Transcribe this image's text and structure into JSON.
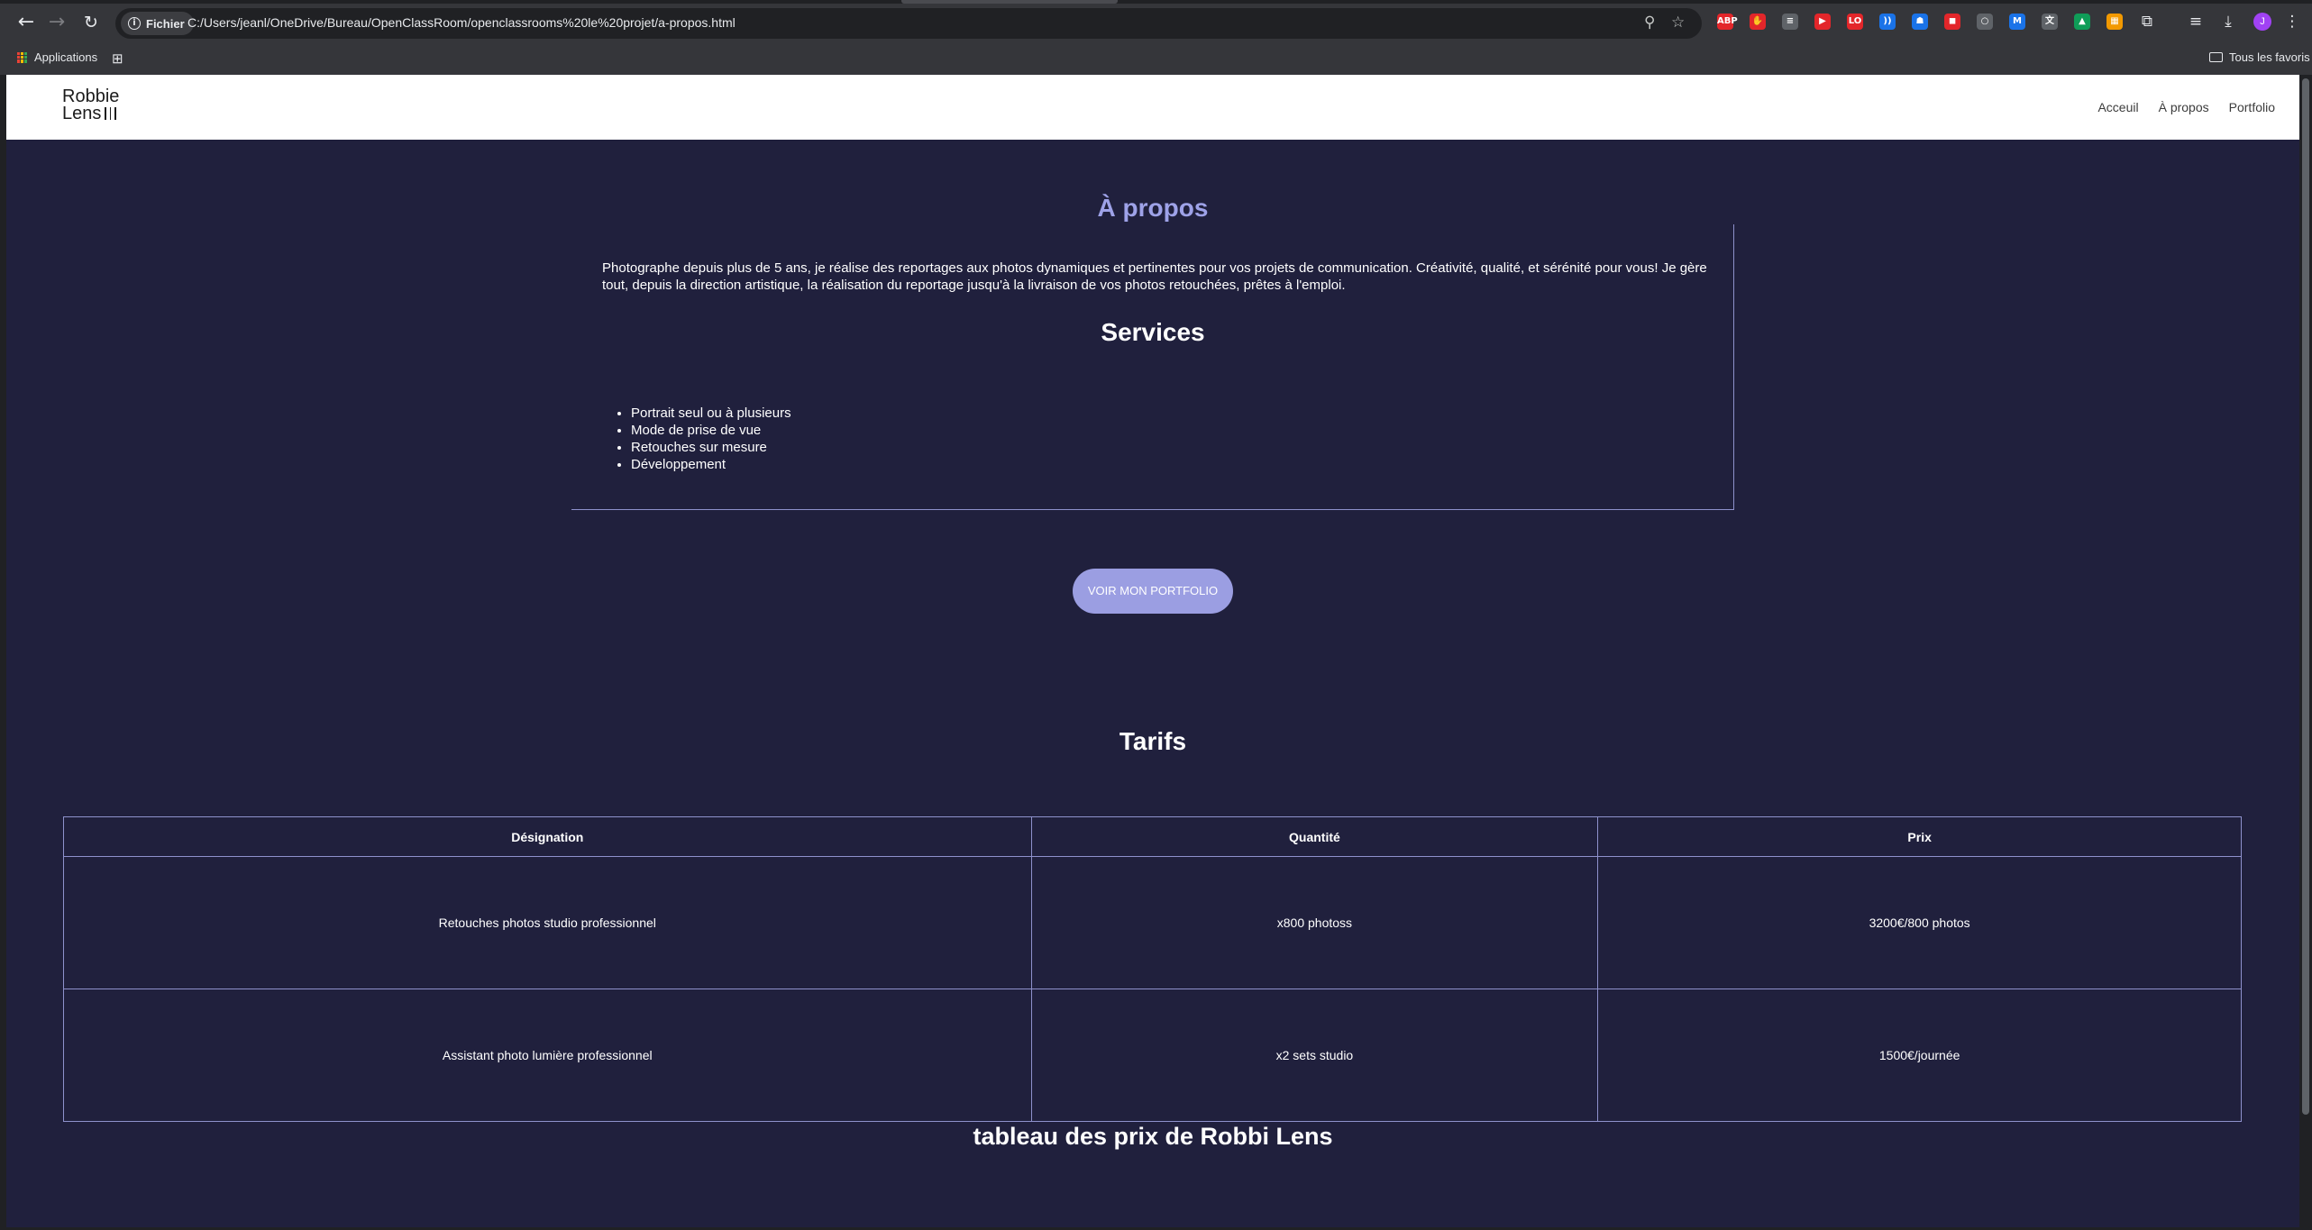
{
  "browser": {
    "url_chip_label": "Fichier",
    "url": "C:/Users/jeanl/OneDrive/Bureau/OpenClassRoom/openclassrooms%20le%20projet/a-propos.html",
    "profile_initial": "J",
    "bookmarks": {
      "applications": "Applications",
      "all_bookmarks": "Tous les favoris"
    },
    "extensions": [
      {
        "label": "ABP",
        "color": "#e3262a"
      },
      {
        "label": "✋",
        "color": "#e3262a"
      },
      {
        "label": "≡",
        "color": "#5f6368"
      },
      {
        "label": "▶",
        "color": "#e3262a"
      },
      {
        "label": "LO",
        "color": "#e3262a"
      },
      {
        "label": "))",
        "color": "#1a73e8"
      },
      {
        "label": "☗",
        "color": "#1a73e8"
      },
      {
        "label": "◼",
        "color": "#e3262a"
      },
      {
        "label": "○",
        "color": "#5f6368"
      },
      {
        "label": "M",
        "color": "#1a73e8"
      },
      {
        "label": "文",
        "color": "#5f6368"
      },
      {
        "label": "▲",
        "color": "#0f9d58"
      },
      {
        "label": "▦",
        "color": "#f29900"
      }
    ]
  },
  "site": {
    "logo_line1": "Robbie",
    "logo_line2": "Lens",
    "nav": [
      "Acceuil",
      "À propos",
      "Portfolio"
    ],
    "about_title": "À propos",
    "about_text": "Photographe depuis plus de 5 ans, je réalise des reportages aux photos dynamiques et pertinentes pour vos projets de communication. Créativité, qualité, et sérénité pour vous! Je gère tout, depuis la direction artistique, la réalisation du reportage jusqu'à la livraison de vos photos retouchées, prêtes à l'emploi.",
    "services_title": "Services",
    "services": [
      "Portrait seul ou à plusieurs",
      "Mode de prise de vue",
      "Retouches sur mesure",
      "Développement"
    ],
    "portfolio_button": "VOIR MON PORTFOLIO",
    "tarifs_title": "Tarifs",
    "table": {
      "headers": [
        "Désignation",
        "Quantité",
        "Prix"
      ],
      "rows": [
        [
          "Retouches photos studio professionnel",
          "x800 photoss",
          "3200€/800 photos"
        ],
        [
          "Assistant photo lumière professionnel",
          "x2 sets studio",
          "1500€/journée"
        ]
      ]
    },
    "caption": "tableau des prix de Robbi Lens"
  }
}
